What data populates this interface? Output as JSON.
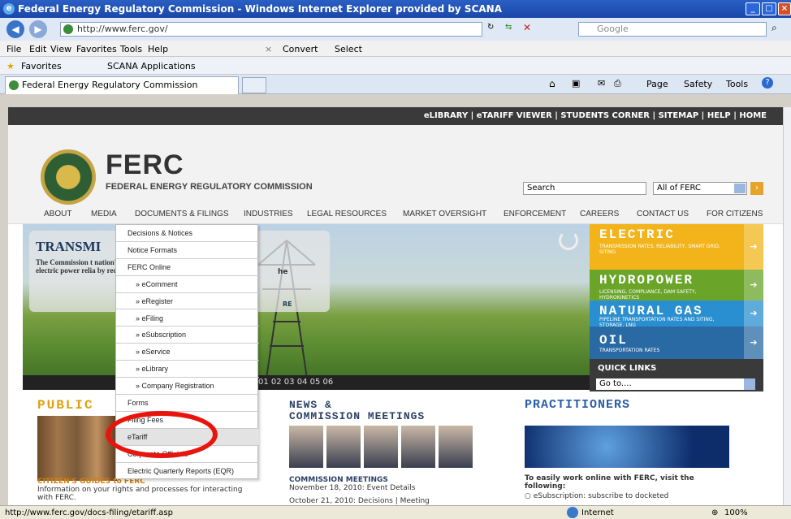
{
  "window": {
    "title": "Federal Energy Regulatory Commission - Windows Internet Explorer provided by SCANA"
  },
  "address": {
    "url": "http://www.ferc.gov/",
    "search_placeholder": "Google"
  },
  "menu": [
    "File",
    "Edit",
    "View",
    "Favorites",
    "Tools",
    "Help"
  ],
  "toolbar": {
    "convert": "Convert",
    "select": "Select"
  },
  "favorites": {
    "label": "Favorites",
    "scana": "SCANA Applications"
  },
  "tab": {
    "label": "Federal Energy Regulatory Commission"
  },
  "commandbar": {
    "page": "Page",
    "safety": "Safety",
    "tools": "Tools"
  },
  "site": {
    "toplinks": "eLIBRARY | eTARIFF VIEWER | STUDENTS CORNER | SITEMAP | HELP | HOME",
    "logo": "FERC",
    "logo_sub": "FEDERAL ENERGY REGULATORY COMMISSION",
    "search": "Search",
    "scope": "All of FERC",
    "nav": [
      "ABOUT",
      "MEDIA",
      "DOCUMENTS & FILINGS",
      "INDUSTRIES",
      "LEGAL RESOURCES",
      "MARKET OVERSIGHT",
      "ENFORCEMENT",
      "CAREERS",
      "CONTACT US",
      "FOR CITIZENS"
    ],
    "hero": {
      "heading": "TRANSMI",
      "text": "The Commission t nation's transmissi electric power relia by reducing transn",
      "text_right": "he",
      "more": "RE",
      "slides": "01  02  03  04  05  06"
    },
    "promos": [
      {
        "title": "ELECTRIC",
        "sub": "TRANSMISSION RATES, RELIABILITY, SMART GRID, SITING",
        "color": "#f2b41a"
      },
      {
        "title": "HYDROPOWER",
        "sub": "LICENSING, COMPLIANCE, DAM SAFETY, HYDROKINETICS",
        "color": "#6aa52a"
      },
      {
        "title": "NATURAL GAS",
        "sub": "PIPELINE TRANSPORTATION RATES AND SITING, STORAGE, LNG",
        "color": "#2a8fd0"
      },
      {
        "title": "OIL",
        "sub": "TRANSPORTATION RATES",
        "color": "#2a6aa4"
      }
    ],
    "quick_links": {
      "label": "QUICK LINKS",
      "select": "Go to...."
    },
    "public": {
      "heading": "PUBLIC",
      "guide_title": "CITIZEN'S GUIDES to FERC",
      "guide_text": "Information on your rights and processes for interacting with FERC."
    },
    "news": {
      "heading_line1": "NEWS &",
      "heading_line2": "COMMISSION MEETINGS",
      "meetings_title": "COMMISSION MEETINGS",
      "meeting1": "November 18, 2010: Event Details",
      "meeting2": "October 21, 2010: Decisions | Meeting"
    },
    "practitioners": {
      "heading": "PRACTITIONERS",
      "text": "To easily work online with FERC, visit the following:",
      "item": "eSubscription: subscribe to docketed"
    },
    "dropdown": [
      "Decisions & Notices",
      "Notice Formats",
      "FERC Online",
      "» eComment",
      "» eRegister",
      "» eFiling",
      "» eSubscription",
      "» eService",
      "» eLibrary",
      "» Company Registration",
      "Forms",
      "Filing Fees",
      "eTariff",
      "Corporate Officials",
      "Electric Quarterly Reports (EQR)"
    ]
  },
  "status": {
    "url": "http://www.ferc.gov/docs-filing/etariff.asp",
    "zone": "Internet",
    "zoom": "100%"
  }
}
